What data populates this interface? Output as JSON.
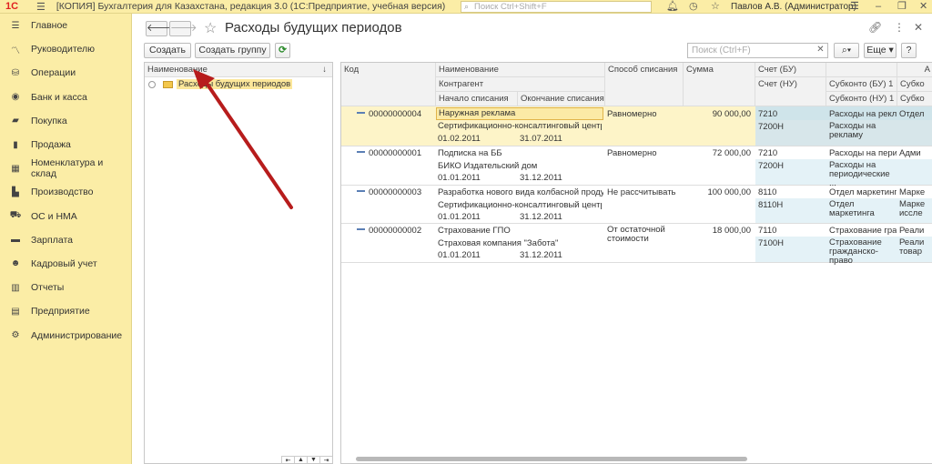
{
  "titlebar": {
    "logo": "1С",
    "app_title": "[КОПИЯ] Бухгалтерия для Казахстана, редакция 3.0 (1С:Предприятие, учебная версия)",
    "search_placeholder": "Поиск Ctrl+Shift+F",
    "user": "Павлов А.В. (Администратор)"
  },
  "sidebar": {
    "items": [
      {
        "label": "Главное",
        "icon": "menu-lines-icon"
      },
      {
        "label": "Руководителю",
        "icon": "trend-icon"
      },
      {
        "label": "Операции",
        "icon": "coins-icon"
      },
      {
        "label": "Банк и касса",
        "icon": "bank-icon"
      },
      {
        "label": "Покупка",
        "icon": "cart-icon"
      },
      {
        "label": "Продажа",
        "icon": "bag-icon"
      },
      {
        "label": "Номенклатура и склад",
        "icon": "grid-icon"
      },
      {
        "label": "Производство",
        "icon": "factory-icon"
      },
      {
        "label": "ОС и НМА",
        "icon": "truck-icon"
      },
      {
        "label": "Зарплата",
        "icon": "money-icon"
      },
      {
        "label": "Кадровый учет",
        "icon": "people-icon"
      },
      {
        "label": "Отчеты",
        "icon": "chart-icon"
      },
      {
        "label": "Предприятие",
        "icon": "building-icon"
      },
      {
        "label": "Администрирование",
        "icon": "gear-icon"
      }
    ]
  },
  "header": {
    "title": "Расходы будущих периодов"
  },
  "toolbar": {
    "create": "Создать",
    "create_group": "Создать группу",
    "search_placeholder": "Поиск (Ctrl+F)",
    "more": "Еще"
  },
  "tree": {
    "column": "Наименование",
    "root": "Расходы будущих периодов"
  },
  "grid": {
    "headers": {
      "code": "Код",
      "name": "Наименование",
      "counterparty": "Контрагент",
      "start": "Начало списания",
      "end": "Окончание списания",
      "method": "Способ списания",
      "sum": "Сумма",
      "acc_bu": "Счет (БУ)",
      "acc_nu": "Счет (НУ)",
      "sub_bu": "Субконто (БУ) 1",
      "sub_nu": "Субконто (НУ) 1",
      "sub_bu2": "Субко",
      "sub_nu2": "Субко",
      "extra": "А"
    },
    "rows": [
      {
        "code": "00000000004",
        "name": "Наружная реклама",
        "counterparty": "Сертификационно-консалтинговый центр Ко...",
        "start": "01.02.2011",
        "end": "31.07.2011",
        "method": "Равномерно",
        "sum": "90 000,00",
        "acc_bu": "7210",
        "acc_nu": "7200Н",
        "sub_bu": "Расходы на рекл...",
        "sub_nu": "Расходы на рекламу",
        "sub_bu2": "Отдел",
        "sub_nu2": ""
      },
      {
        "code": "00000000001",
        "name": "Подписка на ББ",
        "counterparty": "БИКО Издательский дом",
        "start": "01.01.2011",
        "end": "31.12.2011",
        "method": "Равномерно",
        "sum": "72 000,00",
        "acc_bu": "7210",
        "acc_nu": "7200Н",
        "sub_bu": "Расходы на пери...",
        "sub_nu": "Расходы на периодические ...",
        "sub_bu2": "Адми",
        "sub_nu2": ""
      },
      {
        "code": "00000000003",
        "name": "Разработка нового вида колбасной продукци...",
        "counterparty": "Сертификационно-консалтинговый центр Ко...",
        "start": "01.01.2011",
        "end": "31.12.2011",
        "method": "Не рассчитывать",
        "sum": "100 000,00",
        "acc_bu": "8110",
        "acc_nu": "8110Н",
        "sub_bu": "Отдел маркетинга",
        "sub_nu": "Отдел маркетинга",
        "sub_bu2": "Марке",
        "sub_nu2": "Марке иссле"
      },
      {
        "code": "00000000002",
        "name": "Страхование ГПО",
        "counterparty": "Страховая компания \"Забота\"",
        "start": "01.01.2011",
        "end": "31.12.2011",
        "method": "От остаточной стоимости",
        "sum": "18 000,00",
        "acc_bu": "7110",
        "acc_nu": "7100Н",
        "sub_bu": "Страхование гра...",
        "sub_nu": "Страхование гражданско-право",
        "sub_bu2": "Реали",
        "sub_nu2": "Реали товар"
      }
    ]
  },
  "colors": {
    "sidebar_bg": "#fbeda6",
    "selected_row": "#fdf4c8",
    "arrow": "#b71c1c"
  }
}
